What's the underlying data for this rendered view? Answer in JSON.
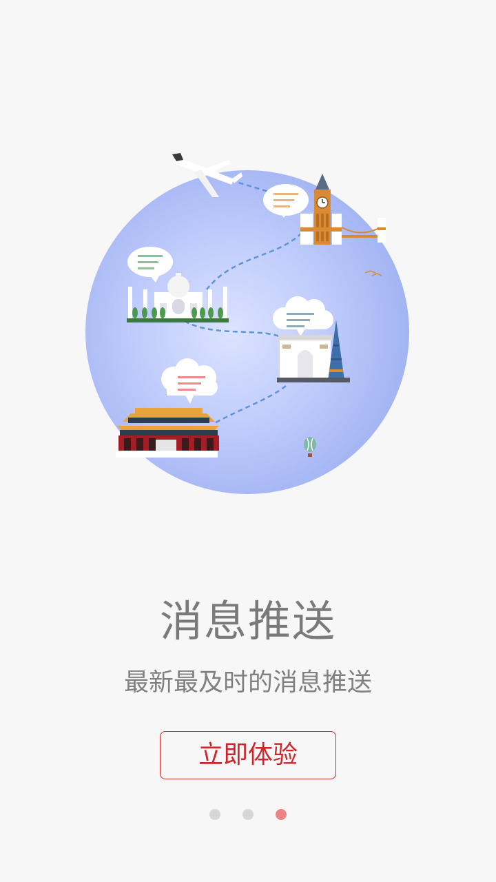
{
  "onboarding": {
    "title": "消息推送",
    "subtitle": "最新最及时的消息推送",
    "cta_label": "立即体验",
    "page_indicator": {
      "total": 3,
      "current": 3
    }
  },
  "colors": {
    "accent": "#d0242a",
    "globe": "#a9baf5",
    "dot_inactive": "#d6d6d6",
    "dot_active": "#ec8484"
  }
}
